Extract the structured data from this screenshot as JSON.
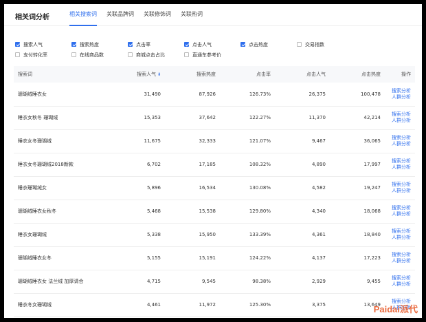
{
  "page": {
    "title": "相关词分析"
  },
  "tabs": [
    {
      "label": "相关搜索词",
      "active": true
    },
    {
      "label": "关联品牌词",
      "active": false
    },
    {
      "label": "关联修饰词",
      "active": false
    },
    {
      "label": "关联热词",
      "active": false
    }
  ],
  "filters": [
    [
      {
        "label": "搜索人气",
        "checked": true
      },
      {
        "label": "搜索热度",
        "checked": true
      },
      {
        "label": "点击率",
        "checked": true
      },
      {
        "label": "点击人气",
        "checked": true
      },
      {
        "label": "点击热度",
        "checked": true
      },
      {
        "label": "交易指数",
        "checked": false
      }
    ],
    [
      {
        "label": "支付转化率",
        "checked": false
      },
      {
        "label": "在线商品数",
        "checked": false
      },
      {
        "label": "商城点击占比",
        "checked": false
      },
      {
        "label": "直通车参考价",
        "checked": false
      }
    ]
  ],
  "table": {
    "headers": [
      "搜索词",
      "搜索人气",
      "搜索热度",
      "点击率",
      "点击人气",
      "点击热度",
      "操作"
    ],
    "sort_indicator": "⬇",
    "action_labels": [
      "搜索分析",
      "人群分析"
    ],
    "rows": [
      [
        "珊瑚绒睡衣女",
        "31,490",
        "87,926",
        "126.73%",
        "26,375",
        "100,478"
      ],
      [
        "睡衣女秋冬 珊瑚绒",
        "15,353",
        "37,642",
        "122.27%",
        "11,370",
        "42,214"
      ],
      [
        "睡衣女冬珊瑚绒",
        "11,675",
        "32,333",
        "121.07%",
        "9,467",
        "36,065"
      ],
      [
        "睡衣女冬珊瑚绒2018新款",
        "6,702",
        "17,185",
        "108.32%",
        "4,890",
        "17,997"
      ],
      [
        "睡衣珊瑚绒女",
        "5,896",
        "16,534",
        "130.08%",
        "4,582",
        "19,247"
      ],
      [
        "珊瑚绒睡衣女秋冬",
        "5,468",
        "15,538",
        "129.80%",
        "4,340",
        "18,068"
      ],
      [
        "睡衣女珊瑚绒",
        "5,338",
        "15,950",
        "133.39%",
        "4,361",
        "18,840"
      ],
      [
        "珊瑚绒睡衣女冬",
        "5,155",
        "15,191",
        "124.22%",
        "4,137",
        "17,223"
      ],
      [
        "珊瑚绒睡衣女 法兰绒 加厚请合",
        "4,715",
        "9,545",
        "98.38%",
        "2,929",
        "9,455"
      ],
      [
        "睡衣冬女珊瑚绒",
        "4,461",
        "11,972",
        "125.30%",
        "3,375",
        "13,649"
      ]
    ]
  },
  "watermark": "Paidai派代",
  "colors": {
    "accent": "#2f6fed",
    "watermark": "#e85a2a"
  }
}
